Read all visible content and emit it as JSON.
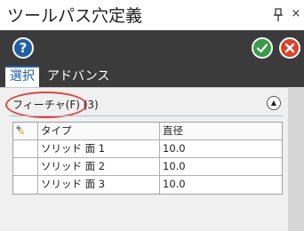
{
  "window": {
    "title": "ツールパス穴定義",
    "pin_icon": "pin-icon",
    "close_glyph": "×"
  },
  "toolbar": {
    "help_glyph": "?",
    "help_icon": "help-icon",
    "ok_icon": "checkmark-icon",
    "cancel_icon": "cancel-x-icon",
    "colors": {
      "help": "#1e5fa8",
      "ok": "#3a9a4a",
      "cancel": "#d2462d"
    }
  },
  "tabs": [
    {
      "label": "選択",
      "selected": true
    },
    {
      "label": "アドバンス",
      "selected": false
    }
  ],
  "feature_section": {
    "label": "フィーチャ(F) (3)",
    "collapse_glyph": "▲",
    "highlight_color": "#e0433f"
  },
  "table": {
    "add_icon_label": "+",
    "edit_icon_label": "✎",
    "columns": [
      "タイプ",
      "直径"
    ],
    "rows": [
      {
        "type": "ソリッド 面 1",
        "diameter": "10.0"
      },
      {
        "type": "ソリッド 面 2",
        "diameter": "10.0"
      },
      {
        "type": "ソリッド 面 3",
        "diameter": "10.0"
      }
    ]
  }
}
